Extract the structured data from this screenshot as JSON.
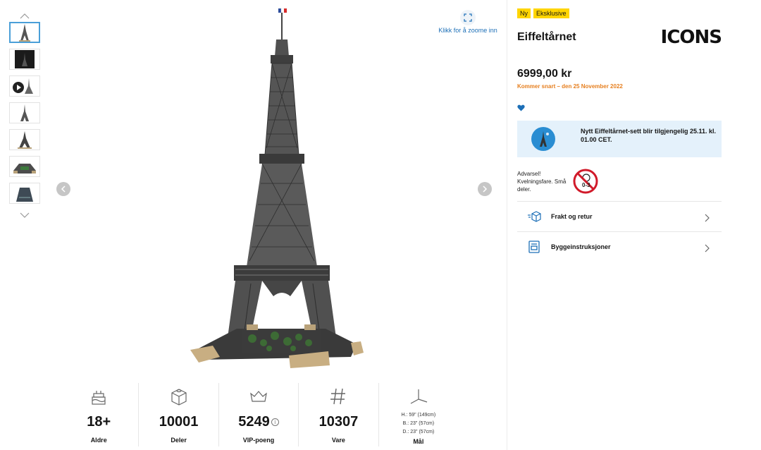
{
  "gallery": {
    "thumbnails": [
      {
        "name": "thumbnail-eiffel-tower",
        "active": true
      },
      {
        "name": "thumbnail-box"
      },
      {
        "name": "thumbnail-video"
      },
      {
        "name": "thumbnail-tower-side"
      },
      {
        "name": "thumbnail-tower-detail"
      },
      {
        "name": "thumbnail-base"
      },
      {
        "name": "thumbnail-platform"
      }
    ],
    "zoom_label": "Klikk for å zoome inn",
    "icons": {
      "prev": "chevron-left-icon",
      "next": "chevron-right-icon",
      "zoom": "expand-icon"
    }
  },
  "specs": [
    {
      "value": "18+",
      "label": "Aldre",
      "icon": "cake-icon"
    },
    {
      "value": "10001",
      "label": "Deler",
      "icon": "brick-icon"
    },
    {
      "value": "5249",
      "label": "VIP-poeng",
      "icon": "crown-icon",
      "info": "i"
    },
    {
      "value": "10307",
      "label": "Vare",
      "icon": "hash-icon"
    },
    {
      "label": "Mål",
      "icon": "dimensions-icon",
      "dims": [
        "H.: 59\" (149cm)",
        "B.: 23\" (57cm)",
        "D.: 23\" (57cm)"
      ]
    }
  ],
  "product": {
    "badges": [
      "Ny",
      "Eksklusive"
    ],
    "title": "Eiffeltårnet",
    "brand": "ICONS",
    "price": "6999,00 kr",
    "availability": "Kommer snart – den 25 November 2022",
    "notice": "Nytt Eiffeltårnet-sett blir tilgjengelig 25.11. kl. 01.00 CET.",
    "warning": "Advarsel! Kvelningsfare. Små deler.",
    "warning_age": "0-3",
    "rows": [
      {
        "label": "Frakt og retur",
        "icon": "shipping-box-icon"
      },
      {
        "label": "Byggeinstruksjoner",
        "icon": "instructions-icon"
      }
    ]
  },
  "colors": {
    "accent": "#1c6fb7",
    "badge": "#ffd500",
    "availability": "#e67f1f",
    "notice_bg": "#e4f1fb"
  }
}
